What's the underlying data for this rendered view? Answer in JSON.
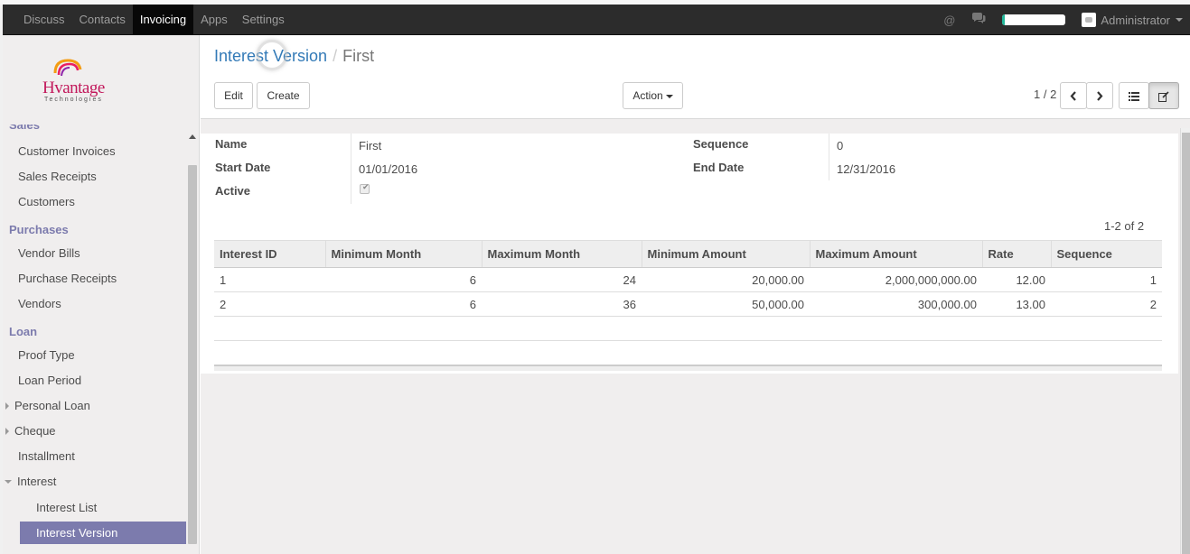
{
  "navbar": {
    "menu": [
      "Discuss",
      "Contacts",
      "Invoicing",
      "Apps",
      "Settings"
    ],
    "active": "Invoicing",
    "user": "Administrator",
    "progress": 0.04,
    "accent_color": "#21b799"
  },
  "logo": {
    "word": "Hvantage",
    "sub": "Technologies"
  },
  "sidebar": {
    "cut_label": "Sales",
    "sales_items": [
      "Customer Invoices",
      "Sales Receipts",
      "Customers"
    ],
    "purchases_label": "Purchases",
    "purchases_items": [
      "Vendor Bills",
      "Purchase Receipts",
      "Vendors"
    ],
    "loan_label": "Loan",
    "loan_items": [
      "Proof Type",
      "Loan Period",
      "Personal Loan",
      "Cheque",
      "Installment",
      "Interest"
    ],
    "interest_items": [
      "Interest List",
      "Interest Version"
    ],
    "active_item": "Interest Version",
    "active_color": "#7c7bad"
  },
  "breadcrumb": {
    "parent": "Interest Version",
    "current": "First",
    "separator": "/"
  },
  "buttons": {
    "edit": "Edit",
    "create": "Create",
    "action": "Action"
  },
  "pager": {
    "value": "1 / 2"
  },
  "form": {
    "name_label": "Name",
    "name_value": "First",
    "start_label": "Start Date",
    "start_value": "01/01/2016",
    "active_label": "Active",
    "active_value": true,
    "sequence_label": "Sequence",
    "sequence_value": "0",
    "end_label": "End Date",
    "end_value": "12/31/2016"
  },
  "list": {
    "pager": "1-2 of 2",
    "columns": [
      "Interest ID",
      "Minimum Month",
      "Maximum Month",
      "Minimum Amount",
      "Maximum Amount",
      "Rate",
      "Sequence"
    ],
    "rows": [
      [
        "1",
        "6",
        "24",
        "20,000.00",
        "2,000,000,000.00",
        "12.00",
        "1"
      ],
      [
        "2",
        "6",
        "36",
        "50,000.00",
        "300,000.00",
        "13.00",
        "2"
      ]
    ]
  }
}
